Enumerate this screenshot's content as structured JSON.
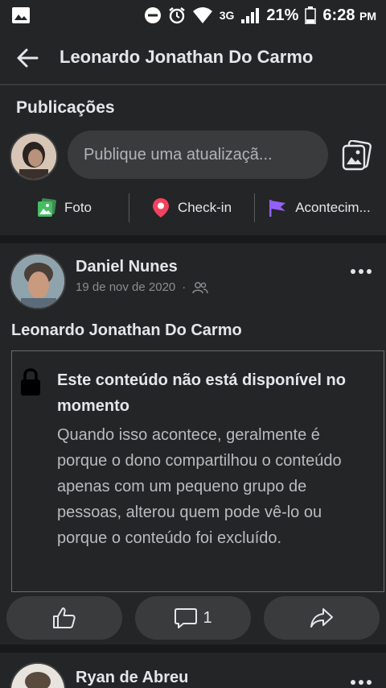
{
  "status_bar": {
    "network": "3G",
    "battery": "21%",
    "time": "6:28",
    "ampm": "PM"
  },
  "app_bar": {
    "title": "Leonardo Jonathan Do Carmo"
  },
  "composer": {
    "section_title": "Publicações",
    "placeholder": "Publique uma atualizaçã...",
    "actions": [
      {
        "label": "Foto",
        "icon": "photo-icon",
        "color": "#45bd62"
      },
      {
        "label": "Check-in",
        "icon": "location-pin-icon",
        "color": "#f3425f"
      },
      {
        "label": "Acontecim...",
        "icon": "flag-icon",
        "color": "#9360f7"
      }
    ]
  },
  "post": {
    "author": "Daniel Nunes",
    "date": "19 de nov de 2020",
    "separator": "·",
    "text": "Leonardo Jonathan Do Carmo",
    "unavailable": {
      "title": "Este conteúdo não está disponível no momento",
      "body": "Quando isso acontece, geralmente é porque o dono compartilhou o conteúdo apenas com um pequeno grupo de pessoas, alterou quem pode vê-lo ou porque o conteúdo foi excluído."
    },
    "comment_count": "1"
  },
  "next_post": {
    "author": "Ryan de Abreu"
  }
}
